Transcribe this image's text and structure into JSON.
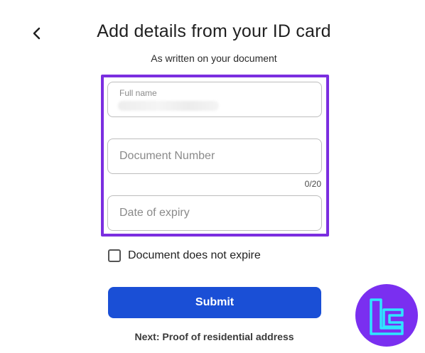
{
  "header": {
    "back_icon": "chevron-left-icon",
    "title": "Add details from your ID card",
    "subtitle": "As written on your document"
  },
  "form": {
    "full_name": {
      "label": "Full name",
      "value_obscured": true
    },
    "document_number": {
      "placeholder": "Document Number",
      "value": "",
      "counter": "0/20"
    },
    "expiry": {
      "placeholder": "Date of expiry",
      "value": ""
    },
    "no_expiry": {
      "label": "Document does not expire",
      "checked": false
    },
    "submit_label": "Submit",
    "next_step": "Next: Proof of residential address"
  },
  "colors": {
    "highlight": "#7b2ee0",
    "primary_button": "#1a4fd6",
    "logo_bg": "#7a2ff0",
    "logo_accent": "#2ee6ff"
  },
  "watermark": {
    "icon": "tc-logo-icon"
  }
}
